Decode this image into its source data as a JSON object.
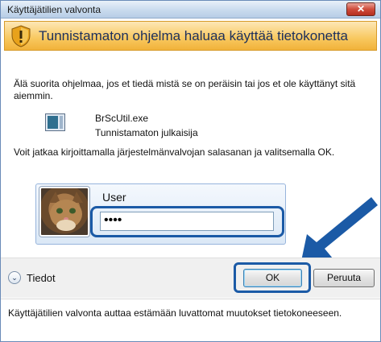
{
  "window": {
    "title": "Käyttäjätilien valvonta",
    "close_label": "✕"
  },
  "banner": {
    "text": "Tunnistamaton ohjelma haluaa käyttää tietokonetta",
    "color": "#f8c85e"
  },
  "message": {
    "intro": "Älä suorita ohjelmaa, jos et tiedä mistä se on peräisin tai jos et ole käyttänyt sitä aiemmin.",
    "file_name": "BrScUtil.exe",
    "publisher": "Tunnistamaton julkaisija",
    "instruction": "Voit jatkaa kirjoittamalla järjestelmänvalvojan salasanan ja valitsemalla OK."
  },
  "credentials": {
    "user_label": "User",
    "password_value": "••••"
  },
  "footer": {
    "details_label": "Tiedot",
    "ok_label": "OK",
    "cancel_label": "Peruuta"
  },
  "footnote": "Käyttäjätilien valvonta auttaa estämään luvattomat muutokset tietokoneeseen.",
  "colors": {
    "highlight": "#1b5aa6",
    "banner": "#f8c85e"
  }
}
